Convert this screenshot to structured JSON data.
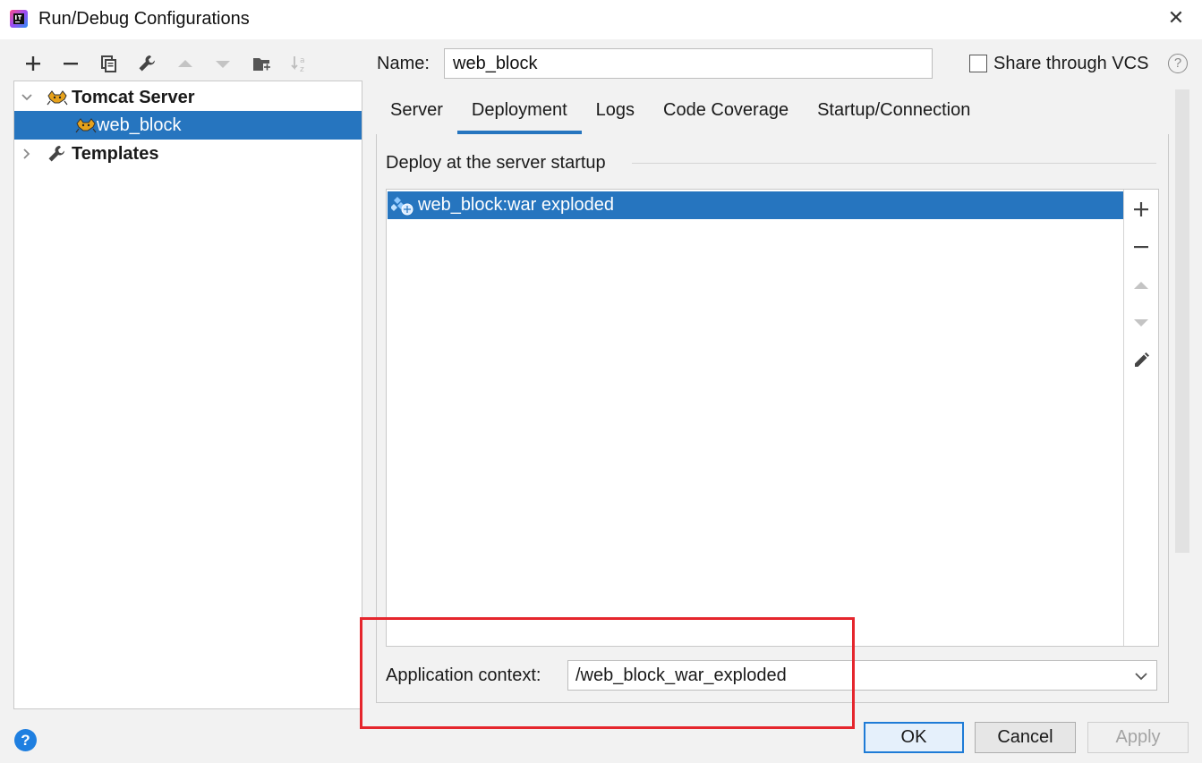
{
  "window": {
    "title": "Run/Debug Configurations",
    "close_glyph": "✕"
  },
  "toolbar": {
    "icons": [
      "add-icon",
      "remove-icon",
      "copy-icon",
      "wrench-icon",
      "move-up-icon",
      "move-down-icon",
      "folder-add-icon",
      "sort-az-icon"
    ]
  },
  "tree": {
    "items": [
      {
        "label": "Tomcat Server",
        "icon": "tomcat-icon",
        "expanded": true
      },
      {
        "label": "web_block",
        "icon": "tomcat-icon",
        "selected": true
      },
      {
        "label": "Templates",
        "icon": "wrench-icon",
        "expanded": false
      }
    ]
  },
  "config": {
    "name_label": "Name:",
    "name_value": "web_block",
    "share_label": "Share through VCS",
    "share_checked": false,
    "help_glyph": "?"
  },
  "tabs": [
    {
      "label": "Server"
    },
    {
      "label": "Deployment",
      "active": true
    },
    {
      "label": "Logs"
    },
    {
      "label": "Code Coverage"
    },
    {
      "label": "Startup/Connection"
    }
  ],
  "deployment": {
    "section_title": "Deploy at the server startup",
    "artifacts": [
      {
        "label": "web_block:war exploded",
        "selected": true
      }
    ],
    "side_buttons": [
      "add-icon",
      "remove-icon",
      "move-up-icon",
      "move-down-icon",
      "edit-icon"
    ],
    "context_label": "Application context:",
    "context_value": "/web_block_war_exploded"
  },
  "buttons": {
    "ok": "OK",
    "cancel": "Cancel",
    "apply": "Apply",
    "help": "?"
  },
  "colors": {
    "selection": "#2675bf",
    "highlight": "#e5262d",
    "ok_border": "#1e7bd6"
  }
}
